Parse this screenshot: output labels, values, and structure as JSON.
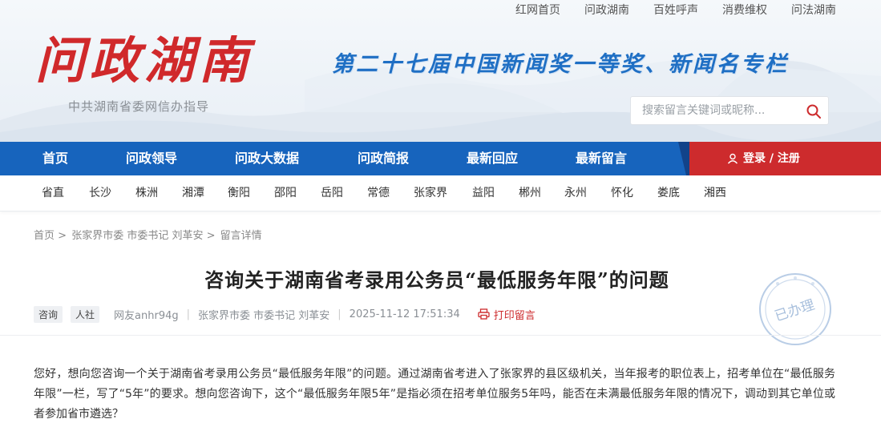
{
  "top_links": [
    "红网首页",
    "问政湖南",
    "百姓呼声",
    "消费维权",
    "问法湖南"
  ],
  "logo": {
    "text": "问政湖南",
    "subtitle": "中共湖南省委网信办指导"
  },
  "slogan": "第二十七届中国新闻奖一等奖、新闻名专栏",
  "search": {
    "placeholder": "搜索留言关键词或昵称...",
    "value": ""
  },
  "nav": {
    "items": [
      "首页",
      "问政领导",
      "问政大数据",
      "问政简报",
      "最新回应",
      "最新留言"
    ],
    "login": "登录 / 注册"
  },
  "regions": [
    "省直",
    "长沙",
    "株洲",
    "湘潭",
    "衡阳",
    "邵阳",
    "岳阳",
    "常德",
    "张家界",
    "益阳",
    "郴州",
    "永州",
    "怀化",
    "娄底",
    "湘西"
  ],
  "breadcrumb": {
    "home": "首页",
    "target": "张家界市委 市委书记 刘革安",
    "current": "留言详情",
    "separator": ">"
  },
  "post": {
    "title": "咨询关于湖南省考录用公务员“最低服务年限”的问题",
    "tags": [
      "咨询",
      "人社"
    ],
    "author": "网友anhr94g",
    "target": "张家界市委 市委书记 刘革安",
    "datetime": "2025-11-12 17:51:34",
    "print_label": "打印留言",
    "status_stamp": "已办理",
    "body": "您好，想向您咨询一个关于湖南省考录用公务员“最低服务年限”的问题。通过湖南省考进入了张家界的县区级机关，当年报考的职位表上，招考单位在“最低服务年限”一栏，写了“5年”的要求。想向您咨询下，这个“最低服务年限5年”是指必须在招考单位服务5年吗，能否在未满最低服务年限的情况下，调动到其它单位或者参加省市遴选？"
  },
  "colors": {
    "nav_blue": "#1764bd",
    "brand_red": "#cd2b2d",
    "slogan_blue": "#1f6fc4"
  }
}
